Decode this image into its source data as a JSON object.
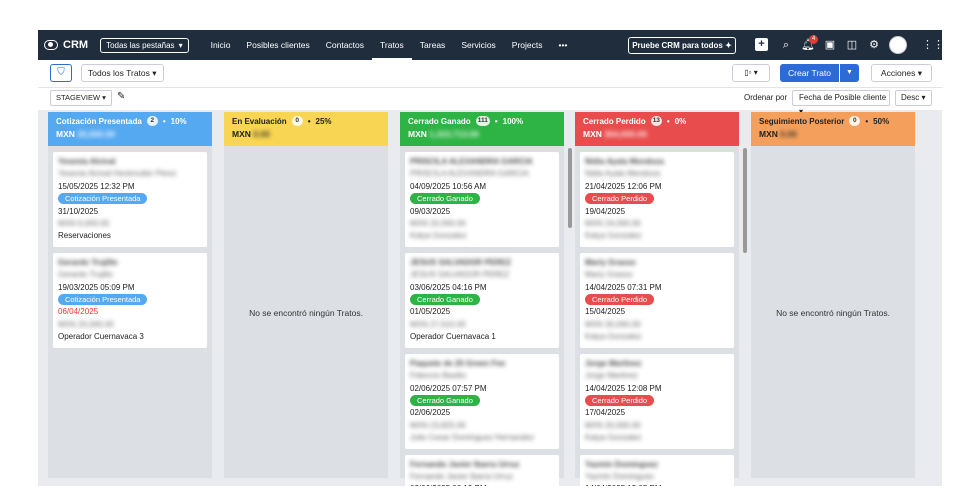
{
  "nav": {
    "app": "CRM",
    "all_tabs": "Todas las pestañas",
    "items": [
      "Inicio",
      "Posibles clientes",
      "Contactos",
      "Tratos",
      "Tareas",
      "Servicios",
      "Projects"
    ],
    "more": "•••",
    "try_btn": "Pruebe CRM para todos",
    "notif_count": "4"
  },
  "toolbar": {
    "view": "Todos los Tratos",
    "create": "Crear Trato",
    "actions": "Acciones",
    "stage": "STAGEVIEW",
    "sort_label": "Ordenar por",
    "sort_by": "Fecha de Posible cliente",
    "sort_order": "Desc"
  },
  "empty_text": "No se encontró ningún Tratos.",
  "columns": [
    {
      "title": "Cotización Presentada",
      "count": "2",
      "pct": "10%",
      "currency": "MXN",
      "amount": "26,000.00",
      "color": "#55a9f0",
      "text_color": "#fff"
    },
    {
      "title": "En Evaluación",
      "count": "0",
      "pct": "25%",
      "currency": "MXN",
      "amount": "0.00",
      "color": "#f8d553",
      "text_color": "#222"
    },
    {
      "title": "Cerrado Ganado",
      "count": "111",
      "pct": "100%",
      "currency": "MXN",
      "amount": "1,323,713.00",
      "color": "#2eb345",
      "text_color": "#fff"
    },
    {
      "title": "Cerrado Perdido",
      "count": "13",
      "pct": "0%",
      "currency": "MXN",
      "amount": "364,000.00",
      "color": "#e84c4c",
      "text_color": "#fff"
    },
    {
      "title": "Seguimiento Posterior",
      "count": "0",
      "pct": "50%",
      "currency": "MXN",
      "amount": "0.00",
      "color": "#f4a05c",
      "text_color": "#222"
    }
  ],
  "cards": {
    "col1": [
      {
        "name": "Yesenia Alcival",
        "contact": "Yesenia Alcival Heckmuller Pérez",
        "created": "15/05/2025 12:32 PM",
        "stage": "Cotización Presentada",
        "close": "31/10/2025",
        "amount": "MXN 6,000.00",
        "owner": "Reservaciones"
      },
      {
        "name": "Gerardo Trujillo",
        "contact": "Gerardo Trujillo",
        "created": "19/03/2025 05:09 PM",
        "stage": "Cotización Presentada",
        "close": "06/04/2025",
        "amount": "MXN 20,000.00",
        "owner": "Operador Cuernavaca 3"
      }
    ],
    "col3": [
      {
        "name": "PRISCILA ALEXANDRA GARCIA",
        "contact": "PRISCILA ALEXANDRA GARCIA",
        "created": "04/09/2025 10:56 AM",
        "stage": "Cerrado Ganado",
        "close": "09/03/2025",
        "amount": "MXN 20,000.00",
        "owner": "Katya Gonzalez"
      },
      {
        "name": "JESUS SALVADOR PEREZ",
        "contact": "JESUS SALVADOR PEREZ",
        "created": "03/06/2025 04:16 PM",
        "stage": "Cerrado Ganado",
        "close": "01/05/2025",
        "amount": "MXN 27,610.00",
        "owner": "Operador Cuernavaca 1"
      },
      {
        "name": "Paquete de 25 Green Fee",
        "contact": "Fidencio Basilio",
        "created": "02/06/2025 07:57 PM",
        "stage": "Cerrado Ganado",
        "close": "02/06/2025",
        "amount": "MXN 23,825.00",
        "owner": "Julio Cesar Dominguez Hernandez"
      },
      {
        "name": "Fernando Javier Ibarra Urruz",
        "contact": "Fernando Javier Ibarra Urruz",
        "created": "02/06/2025 06:19 PM"
      }
    ],
    "col4": [
      {
        "name": "Nidia Ayala Mendoza",
        "contact": "Nidia Ayala Mendoza",
        "created": "21/04/2025 12:06 PM",
        "stage": "Cerrado Perdido",
        "close": "19/04/2025",
        "amount": "MXN 24,000.00",
        "owner": "Katya Gonzalez"
      },
      {
        "name": "Mariy Grasso",
        "contact": "Mariy Grasso",
        "created": "14/04/2025 07:31 PM",
        "stage": "Cerrado Perdido",
        "close": "15/04/2025",
        "amount": "MXN 30,000.00",
        "owner": "Katya Gonzalez"
      },
      {
        "name": "Jorge Martinez",
        "contact": "Jorge Martinez",
        "created": "14/04/2025 12:08 PM",
        "stage": "Cerrado Perdido",
        "close": "17/04/2025",
        "amount": "MXN 20,000.00",
        "owner": "Katya Gonzalez"
      },
      {
        "name": "Yazmin Dominguez",
        "contact": "Yazmin Dominguez",
        "created": "14/04/2025 12:05 PM"
      }
    ]
  },
  "pill_colors": {
    "blue": "#55a9f0",
    "green": "#2eb345",
    "red": "#e84c4c"
  }
}
